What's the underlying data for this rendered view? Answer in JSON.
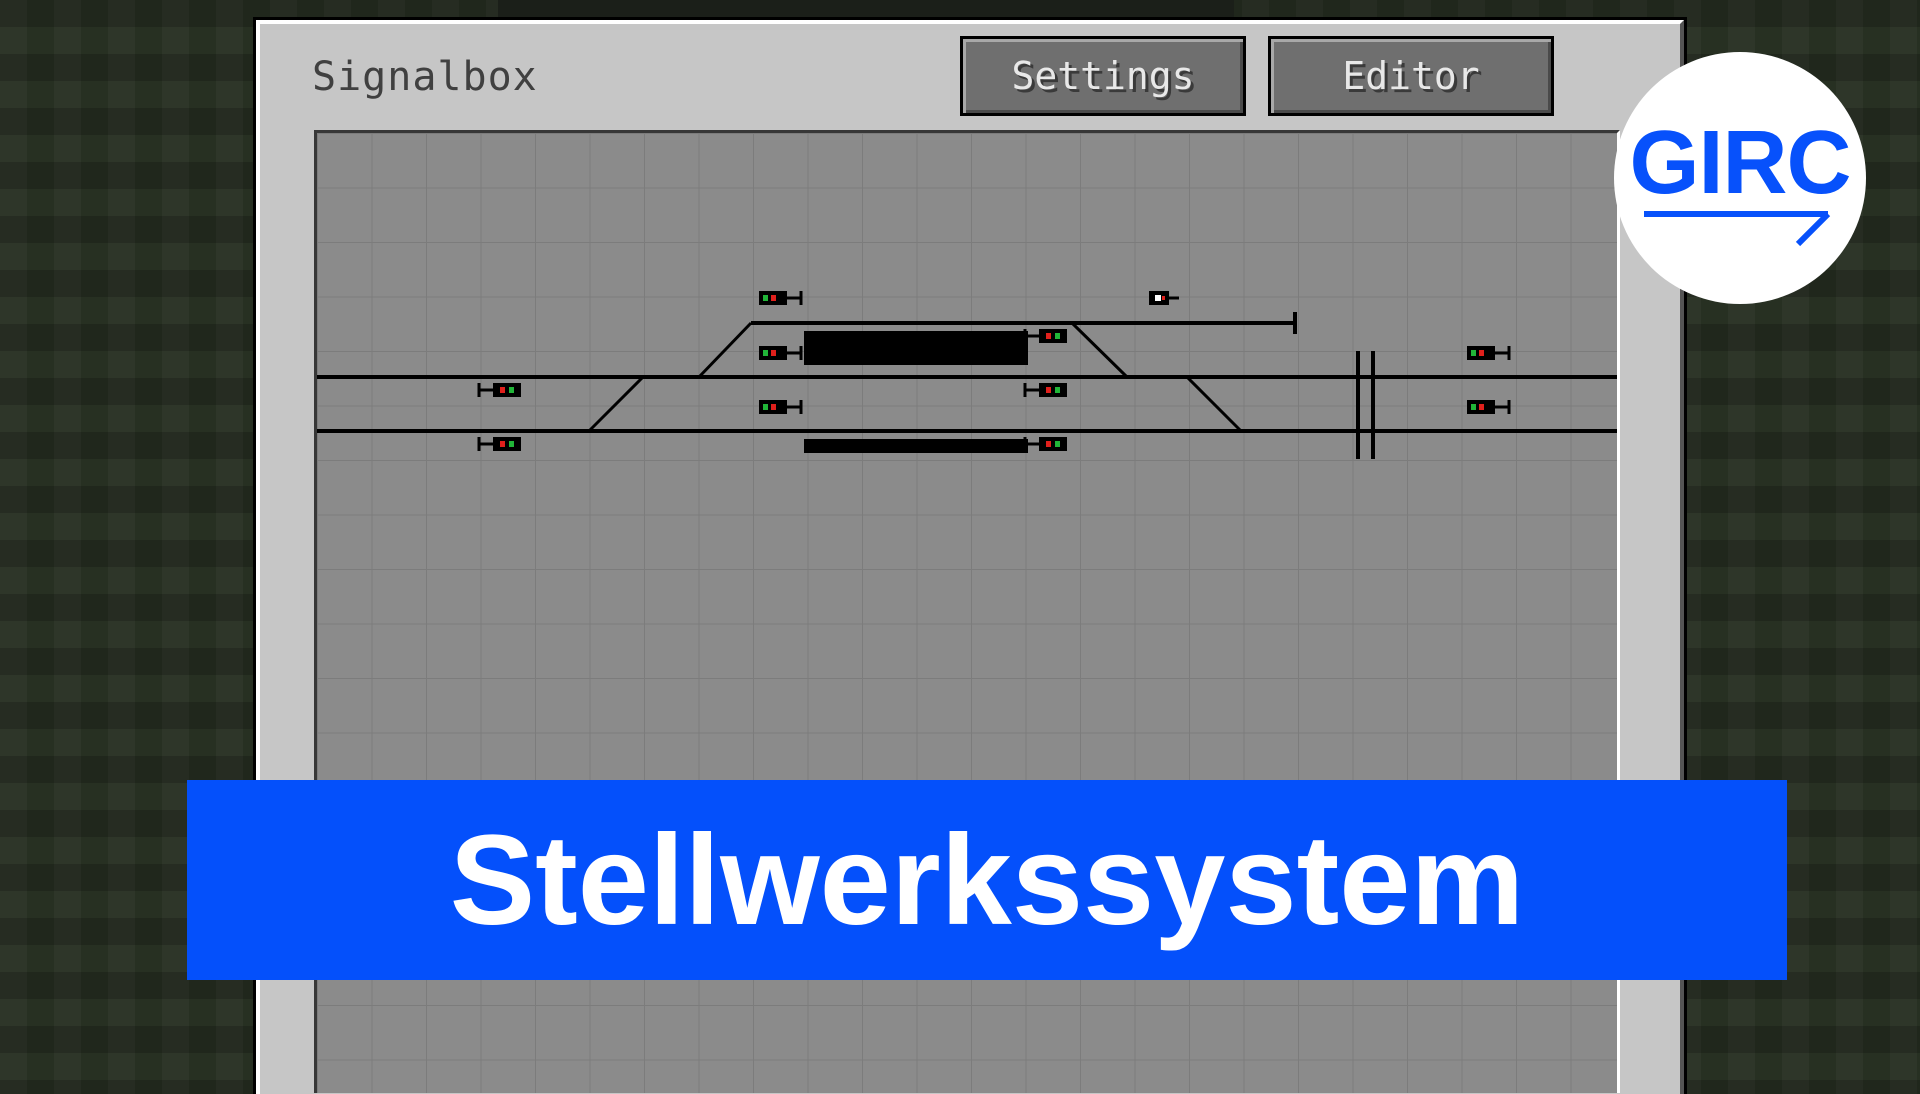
{
  "window": {
    "title": "Signalbox",
    "buttons": {
      "settings_label": "Settings",
      "editor_label": "Editor"
    }
  },
  "logo": {
    "text": "GIRC",
    "color": "#0751fb"
  },
  "banner": {
    "text": "Stellwerkssystem",
    "color": "#0450fb"
  },
  "colors": {
    "canvas": "#8b8b8b",
    "grid": "#7c7c7c",
    "signal_red": "#e0201c",
    "signal_green": "#21b538",
    "signal_white": "#ffffff"
  }
}
